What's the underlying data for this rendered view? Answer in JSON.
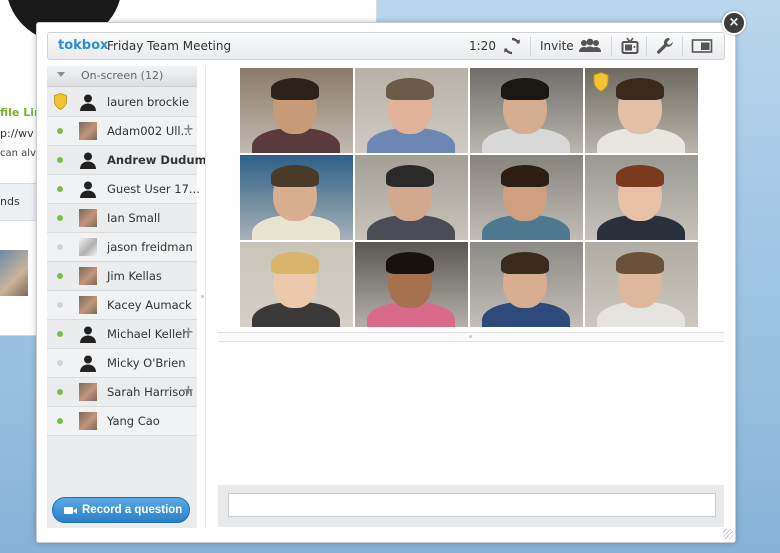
{
  "background_page": {
    "profile_link": "file Lin",
    "url_fragment": "p://wv",
    "note_fragment": "can alv",
    "nav_fragment": "nds"
  },
  "header": {
    "brand": "tokbox",
    "meeting_title": "Friday Team Meeting",
    "timer": "1:20",
    "invite_label": "Invite"
  },
  "icons": {
    "refresh": "refresh-icon",
    "people": "people-icon",
    "tv": "tv-icon",
    "wrench": "wrench-icon",
    "layout": "layout-icon",
    "close": "close-icon"
  },
  "close_glyph": "×",
  "sidebar": {
    "section_label": "On-screen (12)",
    "participants": [
      {
        "name": "lauren brockie",
        "status": "host",
        "bold": false,
        "plus": false,
        "avatar": "silhouette"
      },
      {
        "name": "Adam002 Ull...",
        "status": "online",
        "bold": false,
        "plus": true,
        "avatar": "photo"
      },
      {
        "name": "Andrew Dudum",
        "status": "online",
        "bold": true,
        "plus": false,
        "avatar": "silhouette"
      },
      {
        "name": "Guest User 17...",
        "status": "online",
        "bold": false,
        "plus": false,
        "avatar": "silhouette"
      },
      {
        "name": "Ian Small",
        "status": "online",
        "bold": false,
        "plus": false,
        "avatar": "photo"
      },
      {
        "name": "jason freidman",
        "status": "offline",
        "bold": false,
        "plus": false,
        "avatar": "sketch"
      },
      {
        "name": "Jim Kellas",
        "status": "online",
        "bold": false,
        "plus": false,
        "avatar": "photo"
      },
      {
        "name": "Kacey Aumack",
        "status": "offline",
        "bold": false,
        "plus": false,
        "avatar": "photo"
      },
      {
        "name": "Michael Kelleh",
        "status": "online",
        "bold": false,
        "plus": true,
        "avatar": "silhouette"
      },
      {
        "name": "Micky O'Brien",
        "status": "offline",
        "bold": false,
        "plus": false,
        "avatar": "silhouette"
      },
      {
        "name": "Sarah Harrison",
        "status": "online",
        "bold": false,
        "plus": true,
        "avatar": "photo"
      },
      {
        "name": "Yang Cao",
        "status": "online",
        "bold": false,
        "plus": false,
        "avatar": "photo"
      }
    ],
    "record_button": "Record a question",
    "plus_glyph": "+"
  },
  "video_grid": {
    "rows": 3,
    "cols": 4,
    "tiles": [
      {
        "bg": "#8a7a6a",
        "skin": "#c79a78",
        "hair": "#2b2219",
        "shirt": "#5a3a3a",
        "host": false
      },
      {
        "bg": "#b7b2a8",
        "skin": "#e0b39a",
        "hair": "#6b5a48",
        "shirt": "#6d87b4",
        "host": false
      },
      {
        "bg": "#6f6d6a",
        "skin": "#d6ad90",
        "hair": "#1b1713",
        "shirt": "#d8d8d8",
        "host": false
      },
      {
        "bg": "#6f6a5f",
        "skin": "#e4c0a6",
        "hair": "#3a2a1e",
        "shirt": "#e8e6e0",
        "host": true
      },
      {
        "bg": "#2e5f86",
        "skin": "#d9ae8e",
        "hair": "#4a3a2a",
        "shirt": "#e8e4d2",
        "host": false
      },
      {
        "bg": "#a39e96",
        "skin": "#d2a98f",
        "hair": "#2a2a2a",
        "shirt": "#4a4d55",
        "host": false
      },
      {
        "bg": "#87847d",
        "skin": "#cf9f80",
        "hair": "#2d1e14",
        "shirt": "#4c7890",
        "host": false
      },
      {
        "bg": "#9a9893",
        "skin": "#e8c0a6",
        "hair": "#7a3a1e",
        "shirt": "#2a2f3c",
        "host": false
      },
      {
        "bg": "#c9c4b8",
        "skin": "#ecc8ac",
        "hair": "#d9b46a",
        "shirt": "#3a3a3a",
        "host": false
      },
      {
        "bg": "#5a5652",
        "skin": "#a5714f",
        "hair": "#18120e",
        "shirt": "#d96a8a",
        "host": false
      },
      {
        "bg": "#8c8a86",
        "skin": "#d9ad90",
        "hair": "#3a2a1c",
        "shirt": "#2d4a7a",
        "host": false
      },
      {
        "bg": "#b0aca4",
        "skin": "#ddb89c",
        "hair": "#6a5038",
        "shirt": "#e6e4de",
        "host": false
      }
    ]
  },
  "chat": {
    "input_value": "",
    "input_placeholder": ""
  }
}
